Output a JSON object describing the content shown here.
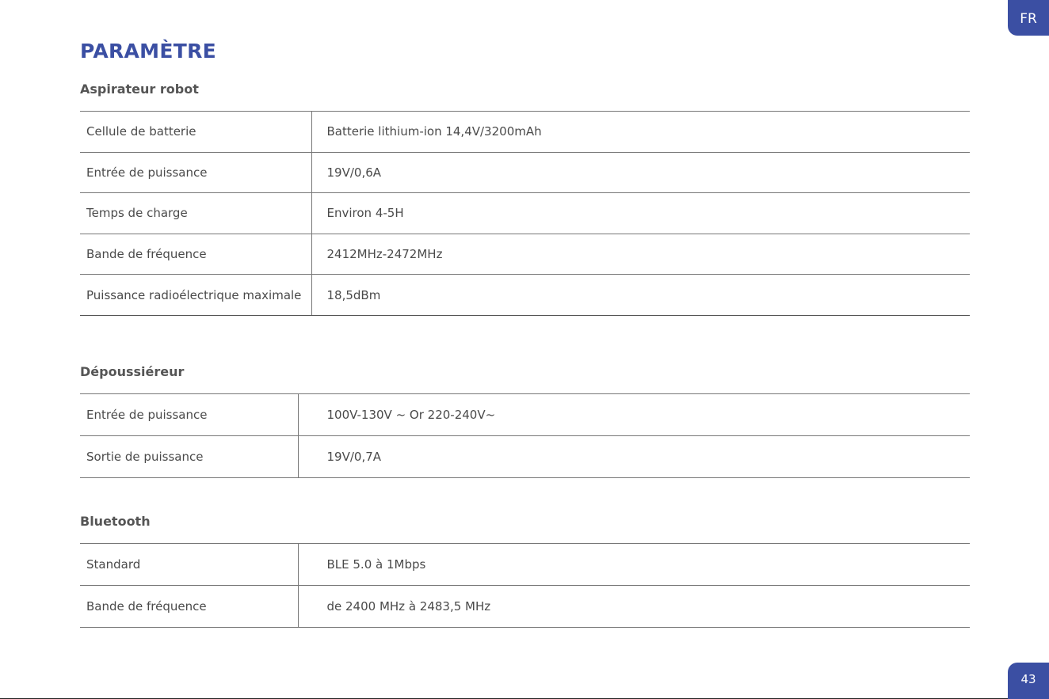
{
  "lang_tab": "FR",
  "page_title": "PARAMÈTRE",
  "page_number": "43",
  "sections": [
    {
      "title": "Aspirateur robot",
      "rows": [
        {
          "label": "Cellule de batterie",
          "value": "Batterie lithium-ion 14,4V/3200mAh"
        },
        {
          "label": "Entrée de puissance",
          "value": "19V/0,6A"
        },
        {
          "label": "Temps de charge",
          "value": "Environ 4-5H"
        },
        {
          "label": "Bande de fréquence",
          "value": "2412MHz-2472MHz"
        },
        {
          "label": "Puissance radioélectrique maximale",
          "value": "18,5dBm"
        }
      ]
    },
    {
      "title": "Dépoussiéreur",
      "rows": [
        {
          "label": "Entrée de puissance",
          "value": "100V-130V ~ Or 220-240V~"
        },
        {
          "label": "Sortie de puissance",
          "value": "19V/0,7A"
        }
      ]
    },
    {
      "title": "Bluetooth",
      "rows": [
        {
          "label": "Standard",
          "value": "BLE 5.0 à 1Mbps"
        },
        {
          "label": "Bande de fréquence",
          "value": "de 2400 MHz à 2483,5 MHz"
        }
      ]
    }
  ],
  "colors": {
    "accent": "#3b4fa3",
    "text": "#4a4a4a",
    "rule": "#777777"
  }
}
